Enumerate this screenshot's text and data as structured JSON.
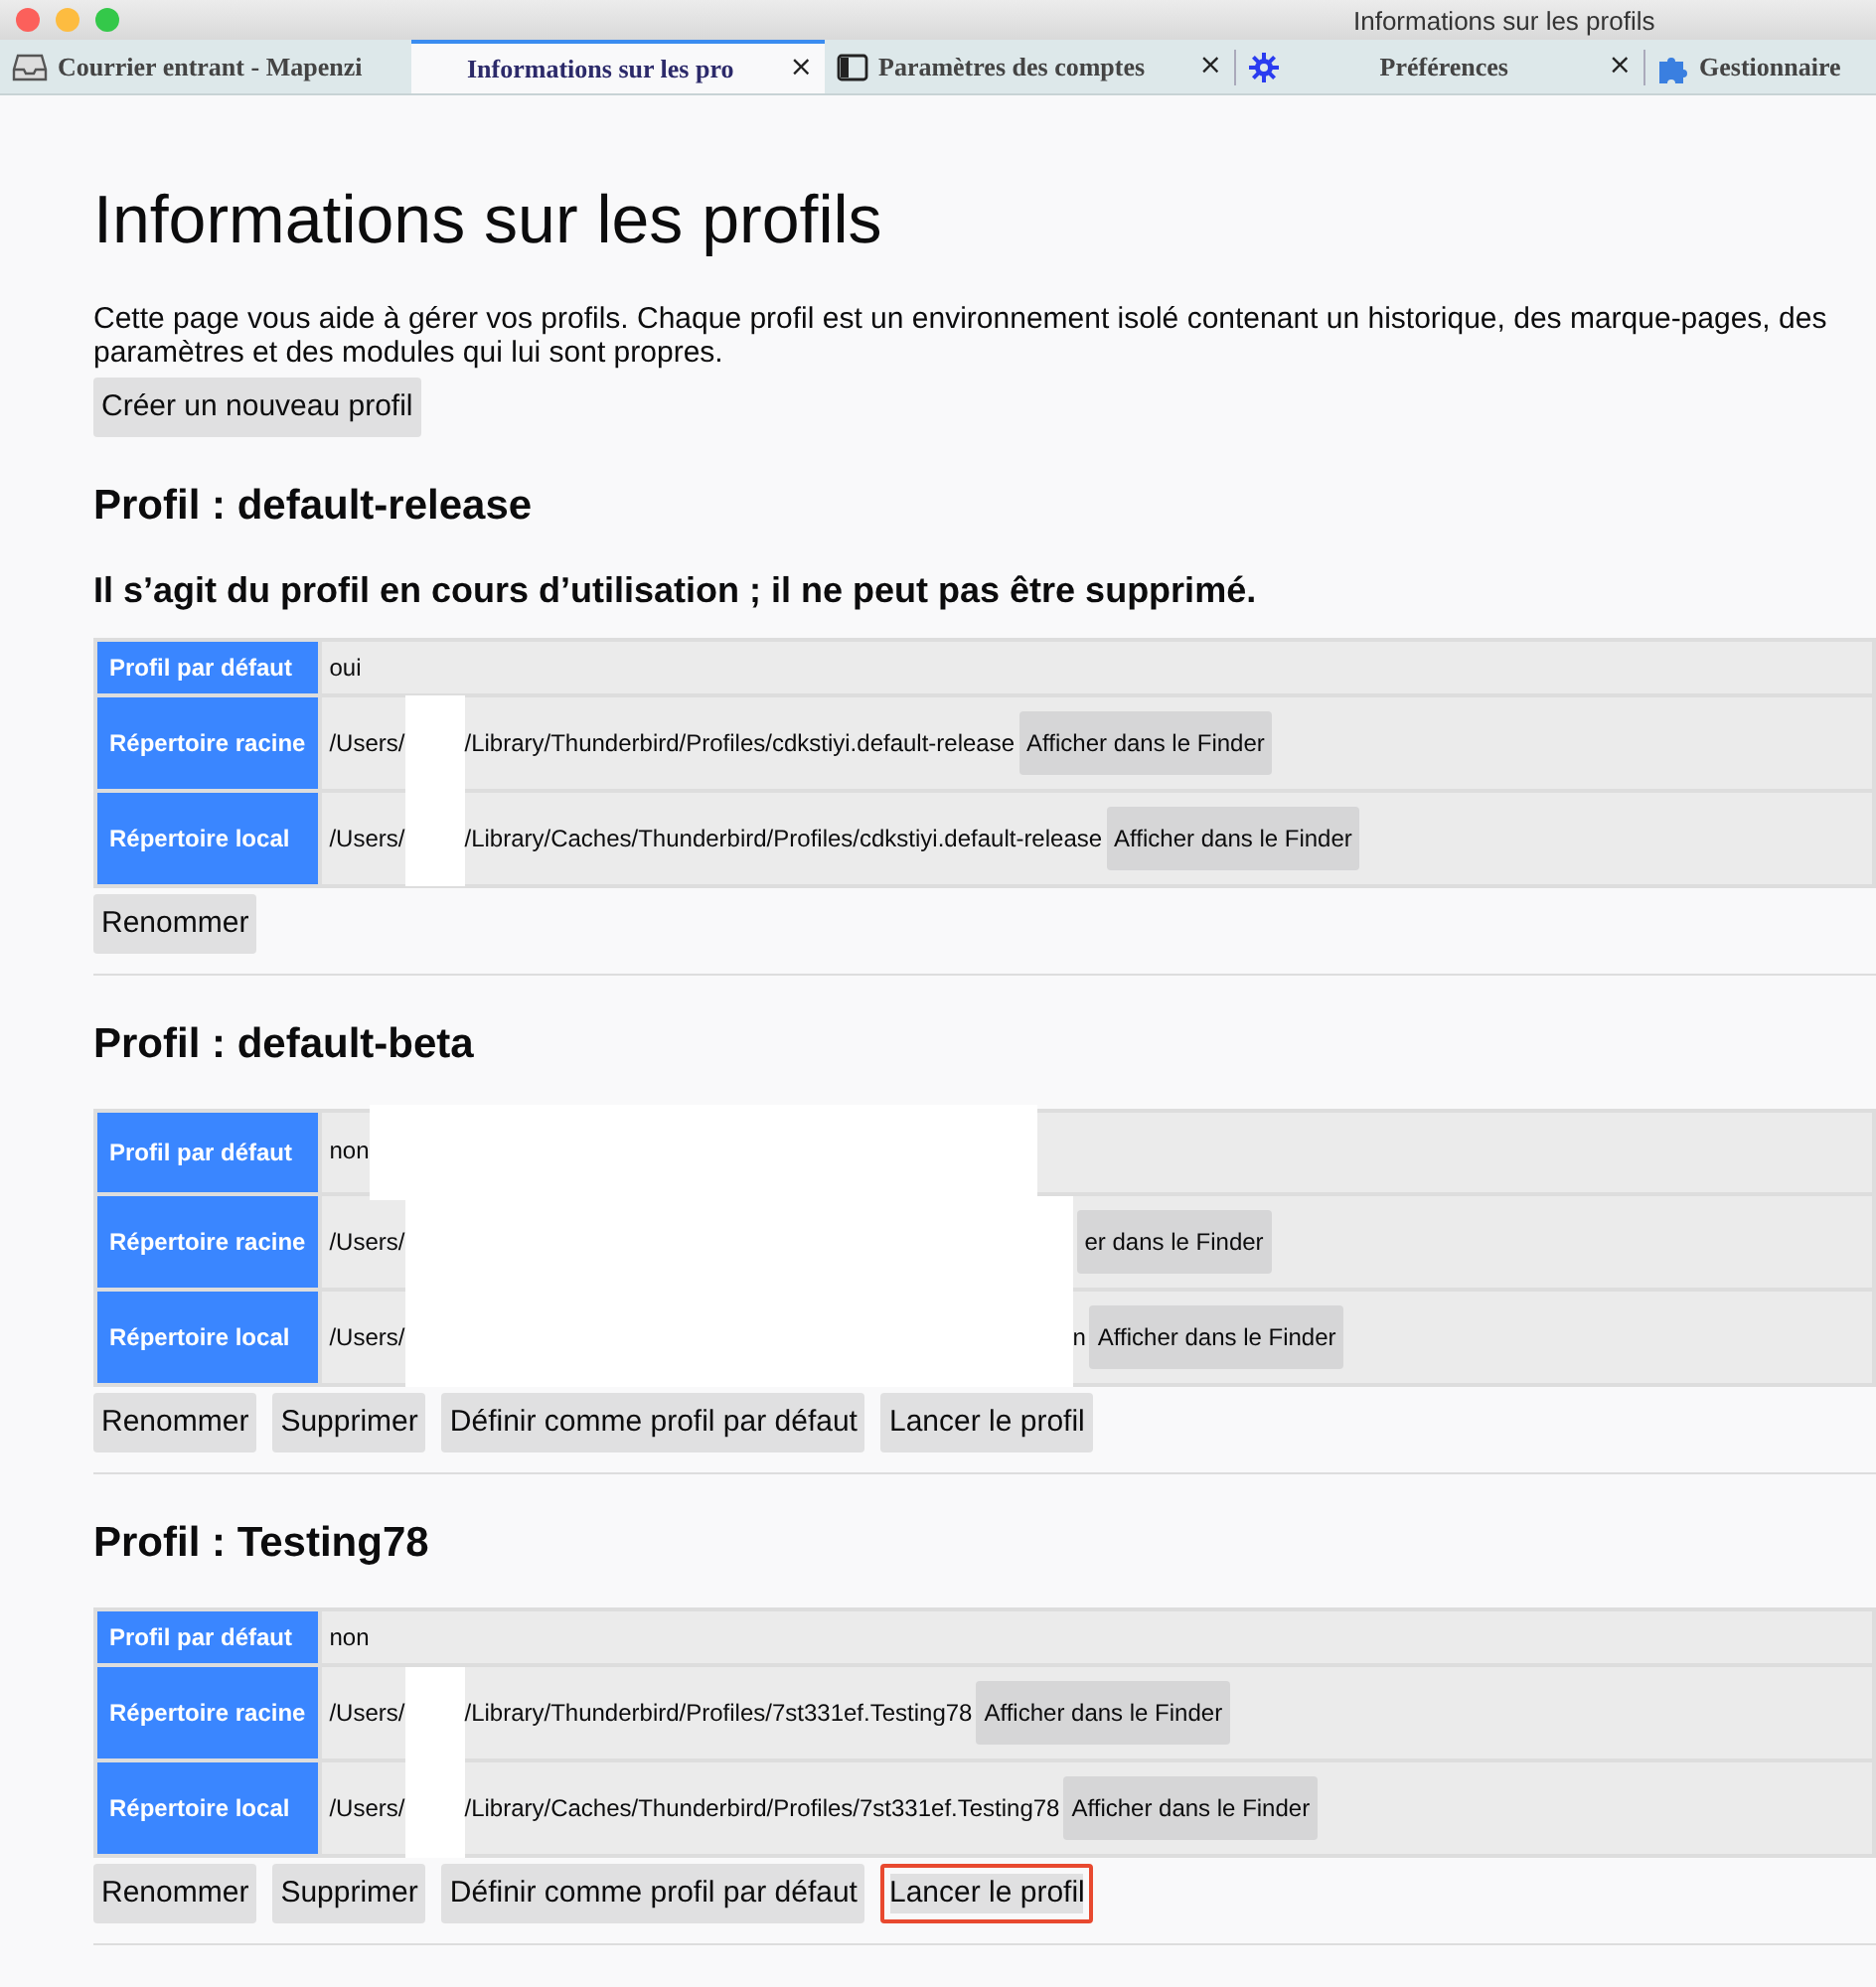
{
  "window": {
    "title": "Informations sur les profils"
  },
  "tabs": [
    {
      "label": "Courrier entrant - Mapenzi",
      "selected": false
    },
    {
      "label": "Informations sur les pro",
      "selected": true,
      "close": "×"
    },
    {
      "label": "Paramètres des comptes",
      "selected": false,
      "close": "×"
    },
    {
      "label": "Préférences",
      "selected": false,
      "close": "×"
    },
    {
      "label": "Gestionnaire",
      "selected": false
    }
  ],
  "heading": "Informations sur les profils",
  "intro": "Cette page vous aide à gérer vos profils. Chaque profil est un environnement isolé contenant un historique, des marque-pages, des paramètres et des modules qui lui sont propres.",
  "create_button": "Créer un nouveau profil",
  "profiles": [
    {
      "title": "Profil : default-release",
      "notice": "Il s’agit du profil en cours d’utilisation ; il ne peut pas être supprimé.",
      "rows": [
        {
          "label": "Profil par défaut",
          "value_before": "oui",
          "redacted": false
        },
        {
          "label": "Répertoire racine",
          "value_before": "/Users/",
          "redacted": true,
          "value_after": "/Library/Thunderbird/Profiles/cdkstiyi.default-release",
          "button": "Afficher dans le Finder"
        },
        {
          "label": "Répertoire local",
          "value_before": "/Users/",
          "redacted": true,
          "value_after": "/Library/Caches/Thunderbird/Profiles/cdkstiyi.default-release",
          "button": "Afficher dans le Finder"
        }
      ],
      "buttons": [
        {
          "label": "Renommer",
          "highlighted": false
        }
      ]
    },
    {
      "title": "Profil : default-beta",
      "rows": [
        {
          "label": "Profil par défaut",
          "value_before": "non",
          "redacted": true
        },
        {
          "label": "Répertoire racine",
          "value_before": "/Users/",
          "redacted": true,
          "button": "er dans le Finder"
        },
        {
          "label": "Répertoire local",
          "value_before": "/Users/",
          "redacted": true,
          "value_after": "n",
          "button": "Afficher dans le Finder"
        }
      ],
      "buttons": [
        {
          "label": "Renommer",
          "highlighted": false
        },
        {
          "label": "Supprimer",
          "highlighted": false
        },
        {
          "label": "Définir comme profil par défaut",
          "highlighted": false
        },
        {
          "label": "Lancer le profil",
          "highlighted": false
        }
      ]
    },
    {
      "title": "Profil : Testing78",
      "rows": [
        {
          "label": "Profil par défaut",
          "value_before": "non",
          "redacted": false
        },
        {
          "label": "Répertoire racine",
          "value_before": "/Users/",
          "redacted": true,
          "value_after": "/Library/Thunderbird/Profiles/7st331ef.Testing78",
          "button": "Afficher dans le Finder"
        },
        {
          "label": "Répertoire local",
          "value_before": "/Users/",
          "redacted": true,
          "value_after": "/Library/Caches/Thunderbird/Profiles/7st331ef.Testing78",
          "button": "Afficher dans le Finder"
        }
      ],
      "buttons": [
        {
          "label": "Renommer",
          "highlighted": false
        },
        {
          "label": "Supprimer",
          "highlighted": false
        },
        {
          "label": "Définir comme profil par défaut",
          "highlighted": false
        },
        {
          "label": "Lancer le profil",
          "highlighted": true
        }
      ]
    }
  ]
}
